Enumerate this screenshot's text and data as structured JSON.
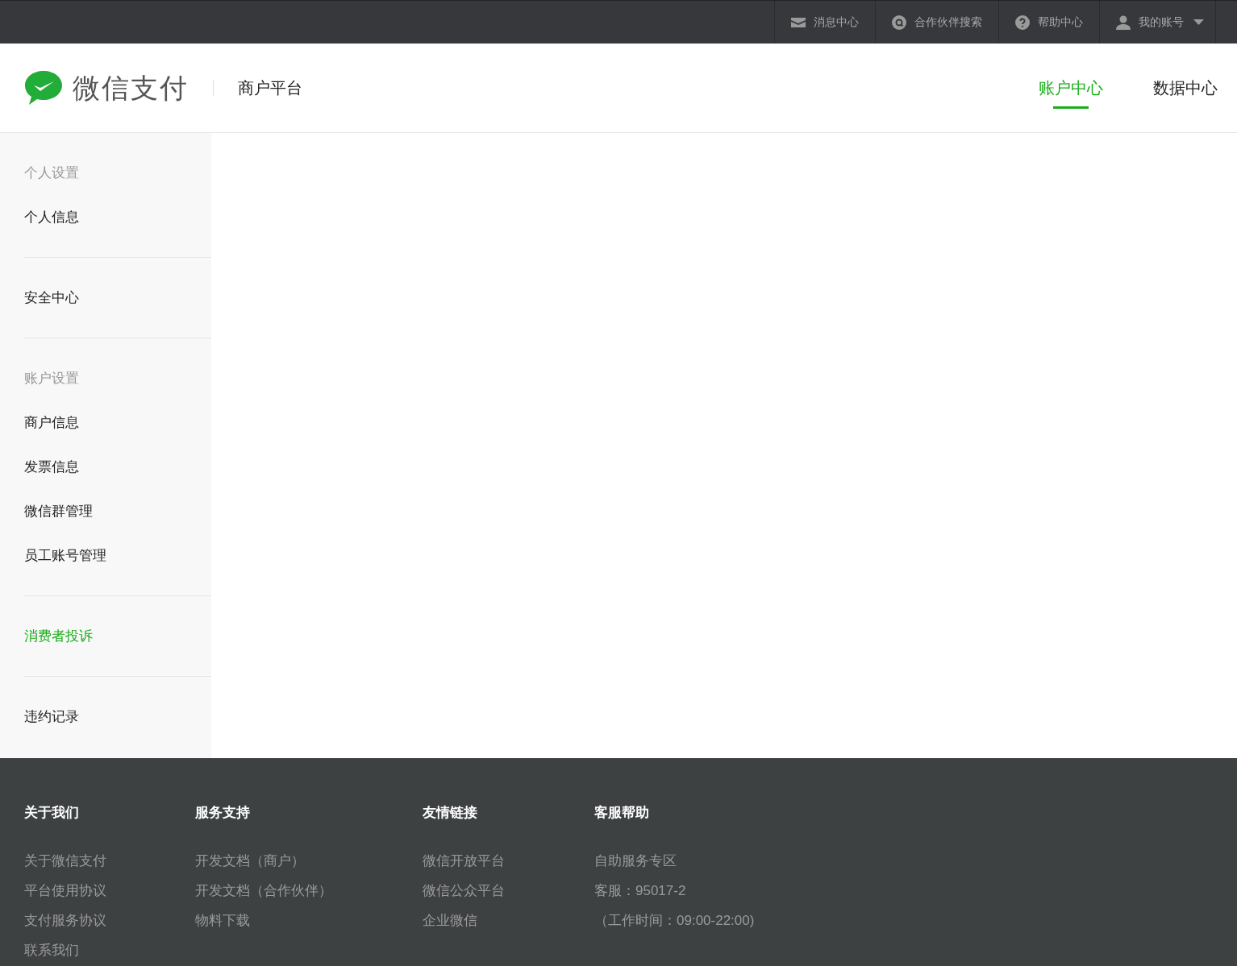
{
  "top_bar": [
    {
      "label": "消息中心"
    },
    {
      "label": "合作伙伴搜索"
    },
    {
      "label": "帮助中心"
    },
    {
      "label": "我的账号"
    }
  ],
  "header": {
    "logo_text": "微信支付",
    "subtitle": "商户平台",
    "nav": [
      {
        "label": "账户中心",
        "selected": true
      },
      {
        "label": "数据中心",
        "selected": false
      }
    ]
  },
  "sidebar": {
    "groups": [
      {
        "items": [
          {
            "kind": "heading",
            "label": "个人设置"
          },
          {
            "kind": "link",
            "label": "个人信息",
            "selected": false
          }
        ]
      },
      {
        "items": [
          {
            "kind": "link",
            "label": "安全中心",
            "selected": false
          }
        ]
      },
      {
        "items": [
          {
            "kind": "heading",
            "label": "账户设置"
          },
          {
            "kind": "link",
            "label": "商户信息",
            "selected": false
          },
          {
            "kind": "link",
            "label": "发票信息",
            "selected": false
          },
          {
            "kind": "link",
            "label": "微信群管理",
            "selected": false
          },
          {
            "kind": "link",
            "label": "员工账号管理",
            "selected": false
          }
        ]
      },
      {
        "items": [
          {
            "kind": "link",
            "label": "消费者投诉",
            "selected": true
          }
        ]
      },
      {
        "items": [
          {
            "kind": "link",
            "label": "违约记录",
            "selected": false
          }
        ]
      }
    ]
  },
  "footer": {
    "columns": [
      {
        "title": "关于我们",
        "links": [
          "关于微信支付",
          "平台使用协议",
          "支付服务协议",
          "联系我们"
        ]
      },
      {
        "title": "服务支持",
        "links": [
          "开发文档（商户）",
          "开发文档（合作伙伴）",
          "物料下载"
        ]
      },
      {
        "title": "友情链接",
        "links": [
          "微信开放平台",
          "微信公众平台",
          "企业微信"
        ]
      },
      {
        "title": "客服帮助",
        "links": [
          "自助服务专区",
          "客服：95017-2",
          "（工作时间：09:00-22:00)"
        ]
      }
    ]
  }
}
